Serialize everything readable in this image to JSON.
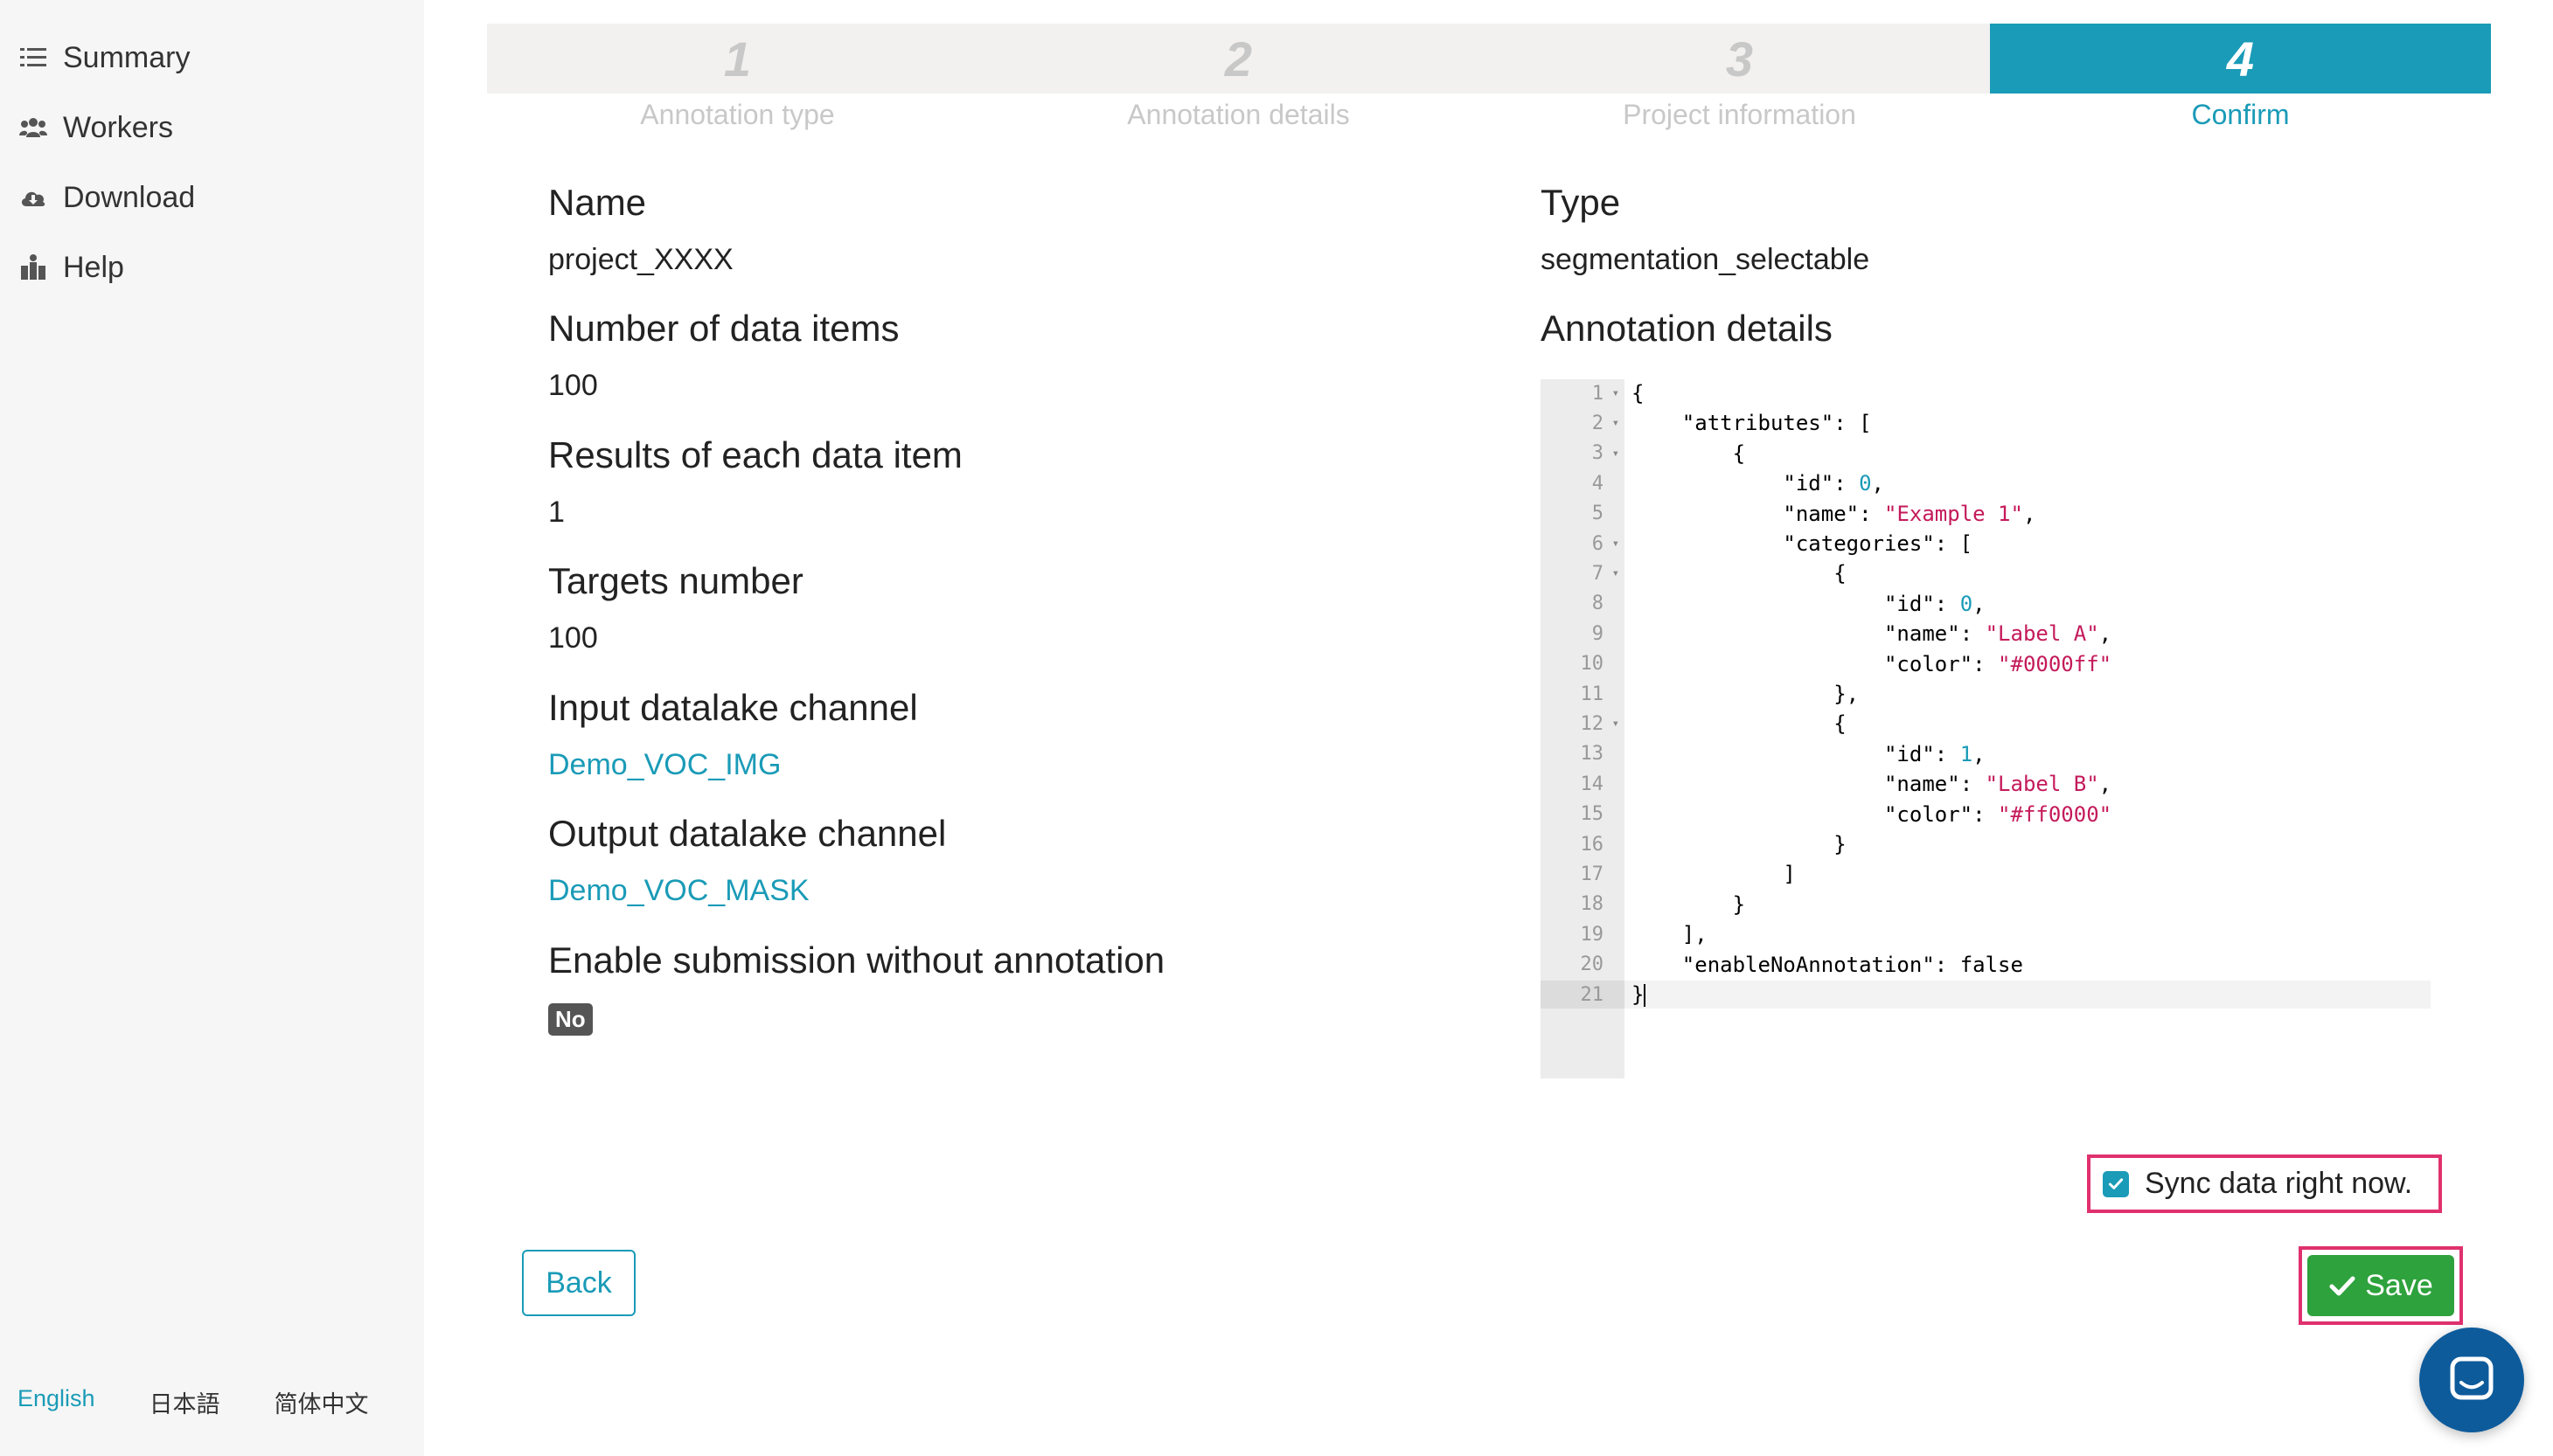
{
  "sidebar": {
    "items": [
      {
        "label": "Summary",
        "icon": "list-icon"
      },
      {
        "label": "Workers",
        "icon": "users-icon"
      },
      {
        "label": "Download",
        "icon": "cloud-download-icon"
      },
      {
        "label": "Help",
        "icon": "help-icon"
      }
    ],
    "languages": [
      "English",
      "日本語",
      "简体中文"
    ],
    "active_language": "English"
  },
  "stepper": {
    "steps": [
      {
        "number": "1",
        "label": "Annotation type"
      },
      {
        "number": "2",
        "label": "Annotation details"
      },
      {
        "number": "3",
        "label": "Project information"
      },
      {
        "number": "4",
        "label": "Confirm"
      }
    ],
    "active_step": 4
  },
  "fields": {
    "name": {
      "label": "Name",
      "value": "project_XXXX"
    },
    "data_items": {
      "label": "Number of data items",
      "value": "100"
    },
    "results": {
      "label": "Results of each data item",
      "value": "1"
    },
    "targets": {
      "label": "Targets number",
      "value": "100"
    },
    "input_channel": {
      "label": "Input datalake channel",
      "value": "Demo_VOC_IMG"
    },
    "output_channel": {
      "label": "Output datalake channel",
      "value": "Demo_VOC_MASK"
    },
    "enable_submission": {
      "label": "Enable submission without annotation",
      "value": "No"
    },
    "type": {
      "label": "Type",
      "value": "segmentation_selectable"
    },
    "annotation_details": {
      "label": "Annotation details"
    }
  },
  "code_lines": [
    "{",
    "    \"attributes\": [",
    "        {",
    "            \"id\": 0,",
    "            \"name\": \"Example 1\",",
    "            \"categories\": [",
    "                {",
    "                    \"id\": 0,",
    "                    \"name\": \"Label A\",",
    "                    \"color\": \"#0000ff\"",
    "                },",
    "                {",
    "                    \"id\": 1,",
    "                    \"name\": \"Label B\",",
    "                    \"color\": \"#ff0000\"",
    "                }",
    "            ]",
    "        }",
    "    ],",
    "    \"enableNoAnnotation\": false",
    "}"
  ],
  "fold_lines": [
    1,
    2,
    3,
    6,
    7,
    12
  ],
  "current_line": 21,
  "actions": {
    "sync_label": "Sync data right now.",
    "sync_checked": true,
    "back_label": "Back",
    "save_label": "Save"
  },
  "colors": {
    "accent": "#1a9bb7",
    "save_green": "#2ea23d",
    "highlight_pink": "#e0316e",
    "string_token": "#c41a5a",
    "chat_fab": "#0d5b9b"
  }
}
